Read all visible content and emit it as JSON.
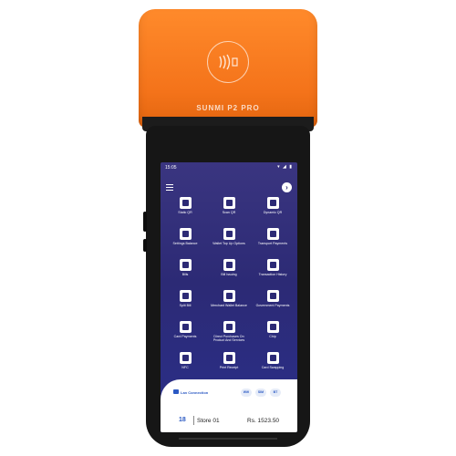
{
  "printer": {
    "brand": "SUNMI P2 PRO",
    "nfc_icon": "contactless-icon"
  },
  "status_bar": {
    "time": "15:05",
    "indicators": "▾ ◢ ▮"
  },
  "toolbar": {
    "menu_icon": "hamburger-icon",
    "next_label": "›"
  },
  "tiles": [
    {
      "label": "Static QR"
    },
    {
      "label": "Scan QR"
    },
    {
      "label": "Dynamic QR"
    },
    {
      "label": "Settings Balance"
    },
    {
      "label": "Wallet Top Up Options"
    },
    {
      "label": "Transport Payments"
    },
    {
      "label": "Bills"
    },
    {
      "label": "Bill Issuing"
    },
    {
      "label": "Transaction History"
    },
    {
      "label": "Split Bill"
    },
    {
      "label": "Merchant Wallet Balance"
    },
    {
      "label": "Government Payments"
    },
    {
      "label": "Card Payments"
    },
    {
      "label": "Direct Purchases On Product And Services"
    },
    {
      "label": "Chip"
    },
    {
      "label": "NFC"
    },
    {
      "label": "Print Receipt"
    },
    {
      "label": "Card Swapping"
    }
  ],
  "connection": {
    "label": "Lan Connection",
    "pills": [
      "Wifi",
      "SIM",
      "BT"
    ]
  },
  "footer": {
    "count": "18",
    "store": "Store 01",
    "amount": "Rs. 1523.50"
  }
}
